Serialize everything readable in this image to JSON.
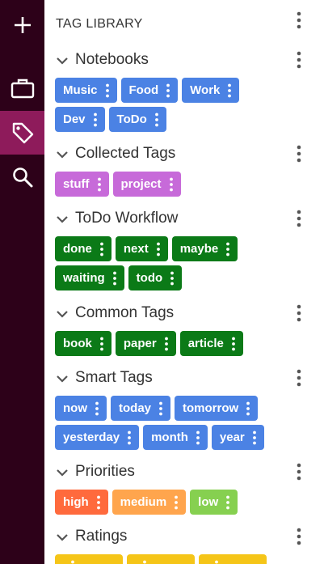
{
  "rail": {
    "items": [
      {
        "name": "add-icon",
        "active": false
      },
      {
        "name": "briefcase-icon",
        "active": false
      },
      {
        "name": "tag-icon",
        "active": true
      },
      {
        "name": "search-icon",
        "active": false
      }
    ]
  },
  "panel": {
    "title": "TAG LIBRARY",
    "sections": [
      {
        "title": "Notebooks",
        "color": "#4b82e4",
        "rows": [
          [
            {
              "label": "Music"
            },
            {
              "label": "Food"
            },
            {
              "label": "Work"
            }
          ],
          [
            {
              "label": "Dev"
            },
            {
              "label": "ToDo"
            }
          ]
        ]
      },
      {
        "title": "Collected Tags",
        "color": "#c76ad9",
        "rows": [
          [
            {
              "label": "stuff"
            },
            {
              "label": "project"
            }
          ]
        ]
      },
      {
        "title": "ToDo Workflow",
        "color": "#0b7a17",
        "rows": [
          [
            {
              "label": "done"
            },
            {
              "label": "next"
            },
            {
              "label": "maybe"
            }
          ],
          [
            {
              "label": "waiting"
            },
            {
              "label": "todo"
            }
          ]
        ]
      },
      {
        "title": "Common Tags",
        "color": "#0b7a17",
        "rows": [
          [
            {
              "label": "book"
            },
            {
              "label": "paper"
            },
            {
              "label": "article"
            }
          ]
        ]
      },
      {
        "title": "Smart Tags",
        "color": "#4b82e4",
        "rows": [
          [
            {
              "label": "now"
            },
            {
              "label": "today"
            },
            {
              "label": "tomorrow"
            }
          ],
          [
            {
              "label": "yesterday"
            },
            {
              "label": "month"
            },
            {
              "label": "year"
            }
          ]
        ]
      },
      {
        "title": "Priorities",
        "rows": [
          [
            {
              "label": "high",
              "color": "#ff6a3d"
            },
            {
              "label": "medium",
              "color": "#ffa54d"
            },
            {
              "label": "low",
              "color": "#86d050"
            }
          ]
        ]
      },
      {
        "title": "Ratings",
        "color": "#f5c518",
        "rows": [
          [
            {
              "label": ""
            },
            {
              "label": ""
            },
            {
              "label": ""
            }
          ]
        ]
      }
    ]
  },
  "colors": {
    "rail_bg": "#2d0119",
    "rail_active": "#8e1b5b",
    "text": "#333333",
    "icon": "#555555"
  }
}
